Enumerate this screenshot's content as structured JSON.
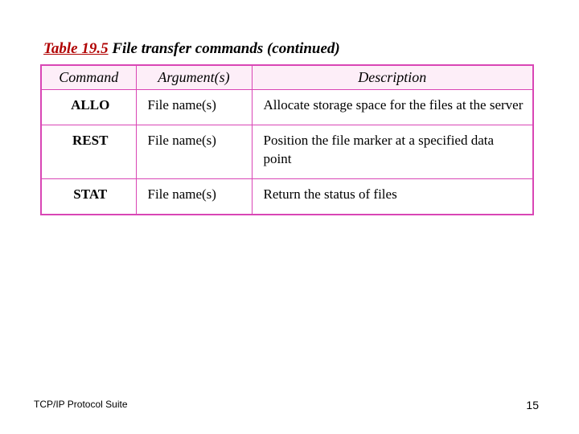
{
  "caption": {
    "prefix": "Table 19.5",
    "rest": "  File transfer commands (continued)"
  },
  "headers": {
    "c1": "Command",
    "c2": "Argument(s)",
    "c3": "Description"
  },
  "rows": [
    {
      "cmd": "ALLO",
      "arg": "File name(s)",
      "desc": "Allocate storage space for the files at the server"
    },
    {
      "cmd": "REST",
      "arg": "File name(s)",
      "desc": "Position the file marker at a specified data point"
    },
    {
      "cmd": "STAT",
      "arg": "File name(s)",
      "desc": "Return the status of files"
    }
  ],
  "footer": {
    "left": "TCP/IP Protocol Suite",
    "right": "15"
  },
  "chart_data": {
    "type": "table",
    "title": "Table 19.5 File transfer commands (continued)",
    "columns": [
      "Command",
      "Argument(s)",
      "Description"
    ],
    "rows": [
      [
        "ALLO",
        "File name(s)",
        "Allocate storage space for the files at the server"
      ],
      [
        "REST",
        "File name(s)",
        "Position the file marker at a specified data point"
      ],
      [
        "STAT",
        "File name(s)",
        "Return the status of files"
      ]
    ]
  }
}
